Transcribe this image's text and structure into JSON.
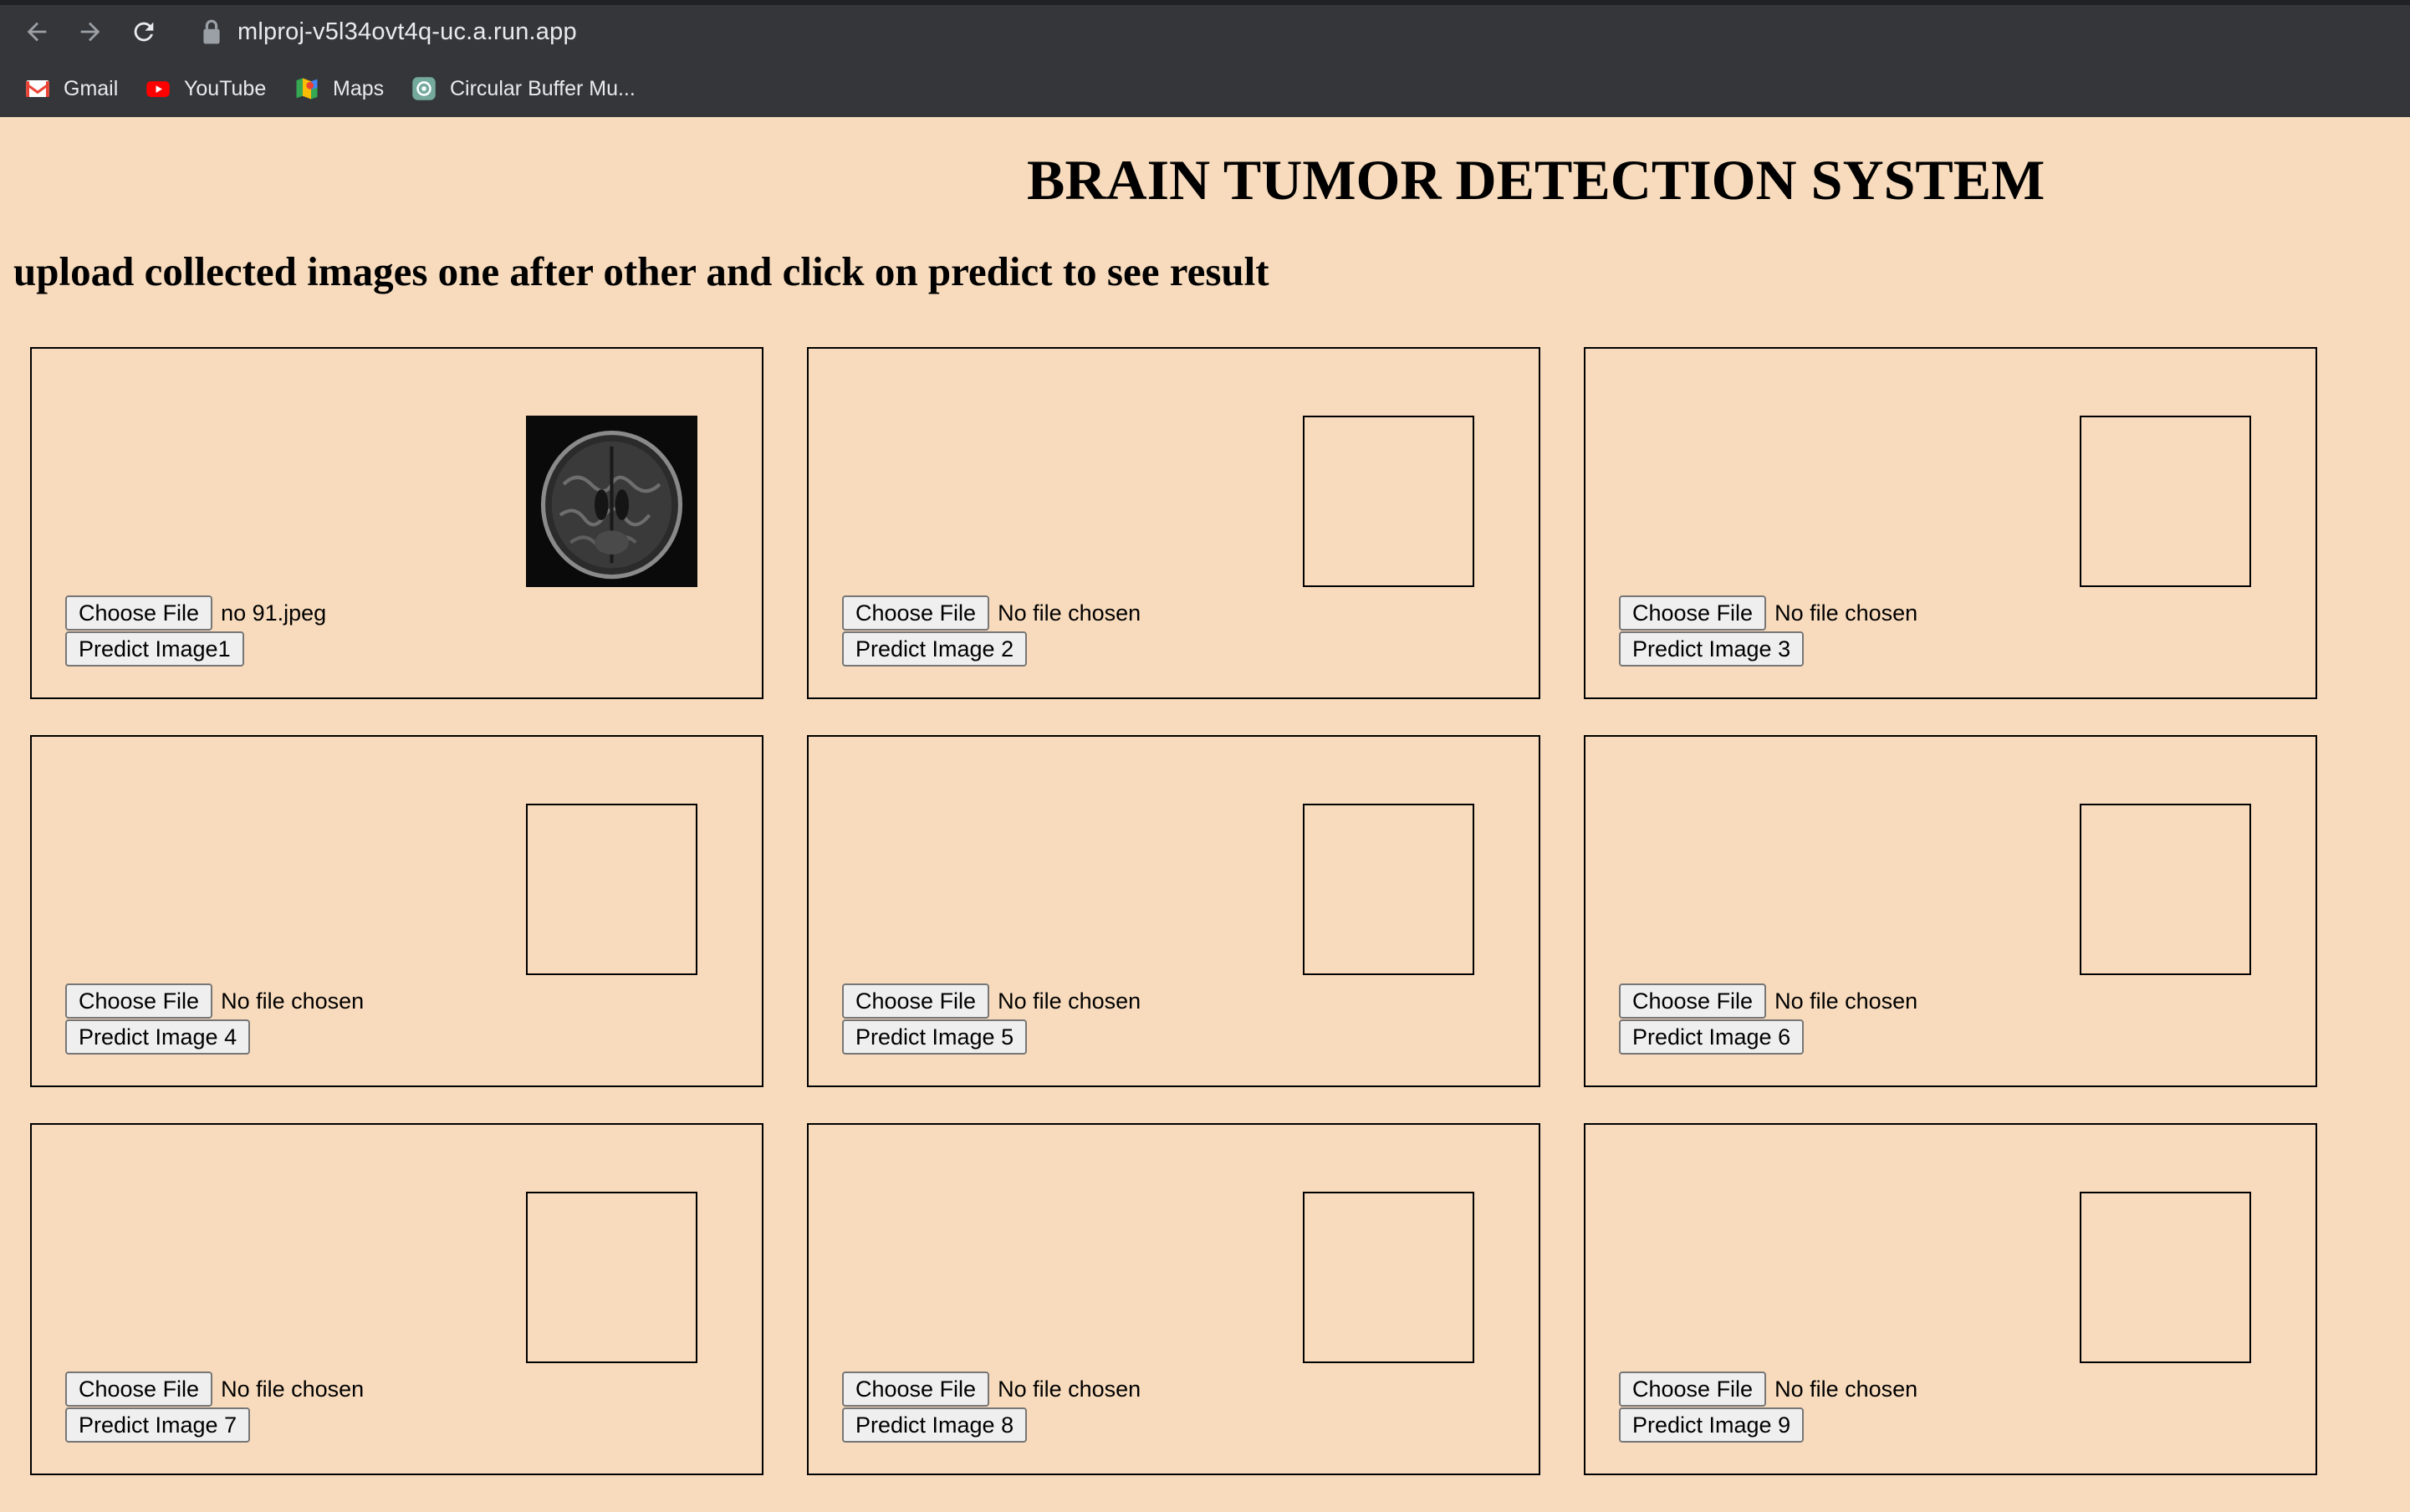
{
  "browser": {
    "url": "mlproj-v5l34ovt4q-uc.a.run.app",
    "bookmarks": [
      {
        "label": "Gmail",
        "icon": "gmail-icon"
      },
      {
        "label": "YouTube",
        "icon": "youtube-icon"
      },
      {
        "label": "Maps",
        "icon": "maps-icon"
      },
      {
        "label": "Circular Buffer Mu...",
        "icon": "openai-icon"
      }
    ]
  },
  "page": {
    "title": "BRAIN TUMOR DETECTION SYSTEM",
    "subtitle": "upload collected images one after other and click on predict to see result"
  },
  "cards": [
    {
      "choose_label": "Choose File",
      "file_name": "no 91.jpeg",
      "predict_label": "Predict Image1",
      "has_image": true
    },
    {
      "choose_label": "Choose File",
      "file_name": "No file chosen",
      "predict_label": "Predict Image 2",
      "has_image": false
    },
    {
      "choose_label": "Choose File",
      "file_name": "No file chosen",
      "predict_label": "Predict Image 3",
      "has_image": false
    },
    {
      "choose_label": "Choose File",
      "file_name": "No file chosen",
      "predict_label": "Predict Image 4",
      "has_image": false
    },
    {
      "choose_label": "Choose File",
      "file_name": "No file chosen",
      "predict_label": "Predict Image 5",
      "has_image": false
    },
    {
      "choose_label": "Choose File",
      "file_name": "No file chosen",
      "predict_label": "Predict Image 6",
      "has_image": false
    },
    {
      "choose_label": "Choose File",
      "file_name": "No file chosen",
      "predict_label": "Predict Image 7",
      "has_image": false
    },
    {
      "choose_label": "Choose File",
      "file_name": "No file chosen",
      "predict_label": "Predict Image 8",
      "has_image": false
    },
    {
      "choose_label": "Choose File",
      "file_name": "No file chosen",
      "predict_label": "Predict Image 9",
      "has_image": false
    }
  ]
}
